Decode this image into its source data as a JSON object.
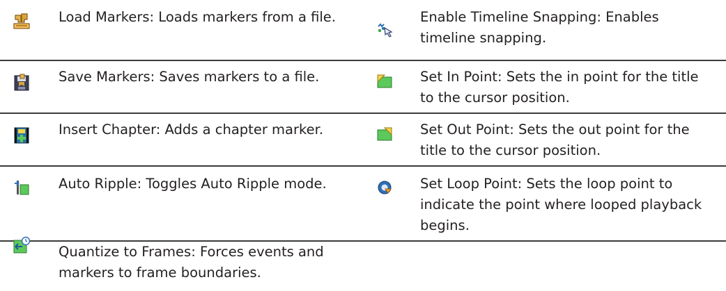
{
  "rows": [
    {
      "left": {
        "icon": "load-markers-icon",
        "text": "Load Markers: Loads markers from a file."
      },
      "right": {
        "icon": "timeline-snapping-icon",
        "text": "Enable Timeline Snapping: Enables timeline snapping."
      }
    },
    {
      "left": {
        "icon": "save-markers-icon",
        "text": "Save Markers: Saves markers to a file."
      },
      "right": {
        "icon": "set-in-point-icon",
        "text": "Set In Point: Sets the in point for the title to the cursor position."
      }
    },
    {
      "left": {
        "icon": "insert-chapter-icon",
        "text": "Insert Chapter: Adds a chapter marker."
      },
      "right": {
        "icon": "set-out-point-icon",
        "text": "Set Out Point: Sets the out point for the title to the cursor position."
      }
    },
    {
      "left": {
        "icon": "auto-ripple-icon",
        "text": "Auto Ripple: Toggles Auto Ripple mode."
      },
      "right": {
        "icon": "set-loop-point-icon",
        "text": "Set Loop Point: Sets the loop point to indicate the point where looped playback begins."
      }
    },
    {
      "left": {
        "icon": "quantize-frames-icon",
        "text": "Quantize to Frames: Forces events and markers to frame boundaries."
      },
      "right": null
    }
  ],
  "colors": {
    "divider": "#3a3a3a",
    "text": "#231f20",
    "marker_orange": "#d9a53a",
    "green": "#5bc95b",
    "blue": "#2f6fb8",
    "yellow": "#f2d24b"
  }
}
